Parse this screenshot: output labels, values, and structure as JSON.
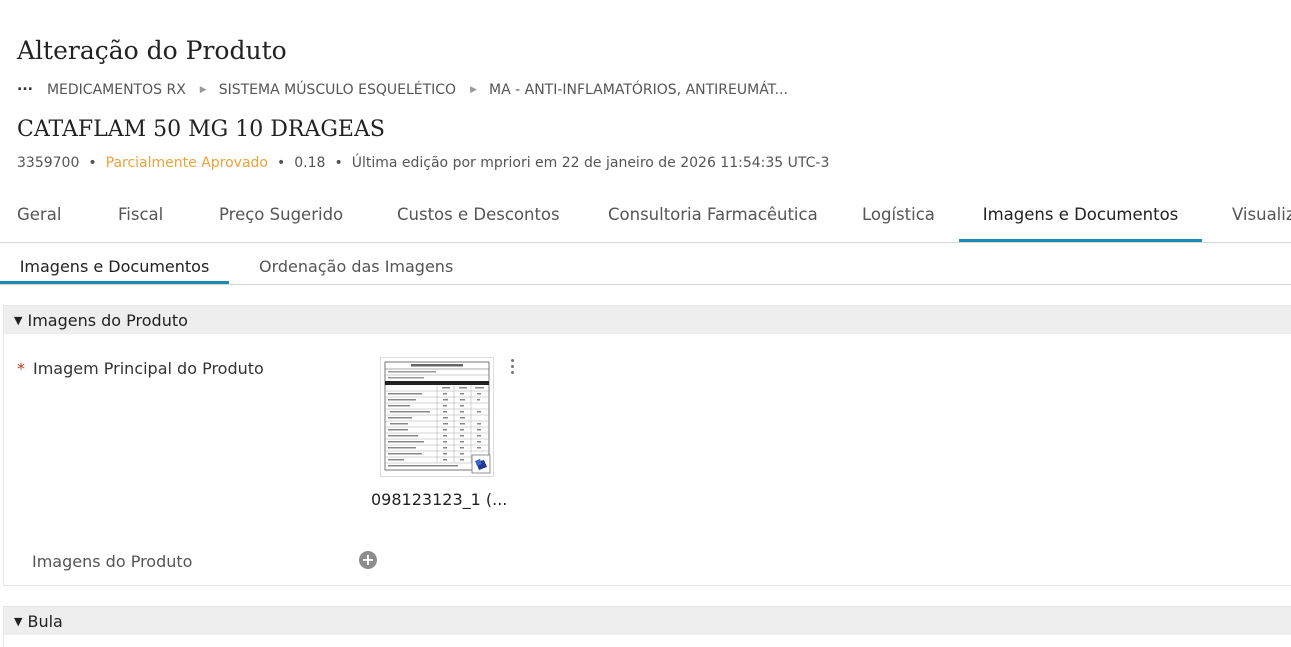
{
  "page": {
    "title": "Alteração do Produto"
  },
  "breadcrumb": {
    "ellipsis": "...",
    "items": [
      "MEDICAMENTOS RX",
      "SISTEMA MÚSCULO ESQUELÉTICO",
      "MA - ANTI-INFLAMATÓRIOS, ANTIREUMÁT..."
    ]
  },
  "product": {
    "name": "CATAFLAM 50 MG 10 DRAGEAS",
    "code": "3359700",
    "status": "Parcialmente Aprovado",
    "status_color": "#e8a33a",
    "version": "0.18",
    "last_edit": "Última edição por mpriori em 22 de janeiro de 2026 11:54:35 UTC-3"
  },
  "tabs": [
    {
      "label": "Geral",
      "active": false
    },
    {
      "label": "Fiscal",
      "active": false
    },
    {
      "label": "Preço Sugerido",
      "active": false
    },
    {
      "label": "Custos e Descontos",
      "active": false
    },
    {
      "label": "Consultoria Farmacêutica",
      "active": false
    },
    {
      "label": "Logística",
      "active": false
    },
    {
      "label": "Imagens e Documentos",
      "active": true
    },
    {
      "label": "Visualiz",
      "active": false
    }
  ],
  "accent_color": "#1b8ab4",
  "subtabs": [
    {
      "label": "Imagens e Documentos",
      "active": true
    },
    {
      "label": "Ordenação das Imagens",
      "active": false
    }
  ],
  "sections": {
    "images": {
      "title": "Imagens do Produto",
      "main_image_label": "Imagem Principal do Produto",
      "required_mark": "*",
      "main_image_filename": "098123123_1 (...",
      "product_images_label": "Imagens do Produto",
      "add_icon": "plus-circle-icon"
    },
    "bula": {
      "title": "Bula"
    }
  }
}
